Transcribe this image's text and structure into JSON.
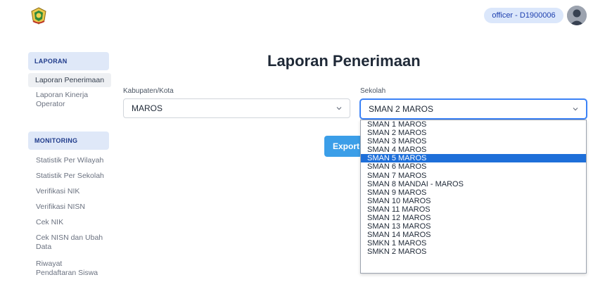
{
  "header": {
    "user_label": "officer - D1900006",
    "logo_icon": "regional-emblem-icon",
    "avatar_icon": "user-avatar-icon"
  },
  "sidebar": {
    "laporan_heading": "LAPORAN",
    "laporan_items": [
      {
        "label": "Laporan Penerimaan",
        "active": true
      },
      {
        "label": "Laporan Kinerja Operator",
        "active": false
      }
    ],
    "monitoring_heading": "MONITORING",
    "monitoring_items": [
      {
        "label": "Statistik Per Wilayah"
      },
      {
        "label": "Statistik Per Sekolah"
      },
      {
        "label": "Verifikasi NIK"
      },
      {
        "label": "Verifikasi NISN"
      },
      {
        "label": "Cek NIK"
      },
      {
        "label": "Cek NISN dan Ubah Data"
      },
      {
        "label": "Riwayat Pendaftaran Siswa"
      }
    ]
  },
  "main": {
    "title": "Laporan Penerimaan",
    "kabupaten": {
      "label": "Kabupaten/Kota",
      "value": "MAROS"
    },
    "sekolah": {
      "label": "Sekolah",
      "value": "SMAN 2 MAROS"
    },
    "export_label": "Export",
    "dropdown_options": [
      "SMAN 1 MAROS",
      "SMAN 2 MAROS",
      "SMAN 3 MAROS",
      "SMAN 4 MAROS",
      "SMAN 5 MAROS",
      "SMAN 6 MAROS",
      "SMAN 7 MAROS",
      "SMAN 8 MANDAI - MAROS",
      "SMAN 9 MAROS",
      "SMAN 10 MAROS",
      "SMAN 11 MAROS",
      "SMAN 12 MAROS",
      "SMAN 13 MAROS",
      "SMAN 14 MAROS",
      "SMKN 1 MAROS",
      "SMKN 2 MAROS"
    ],
    "highlighted_option": "SMAN 5 MAROS"
  },
  "colors": {
    "accent": "#3b9ee8",
    "highlight": "#1e6fd9",
    "section_bg": "#dfe8f8"
  }
}
